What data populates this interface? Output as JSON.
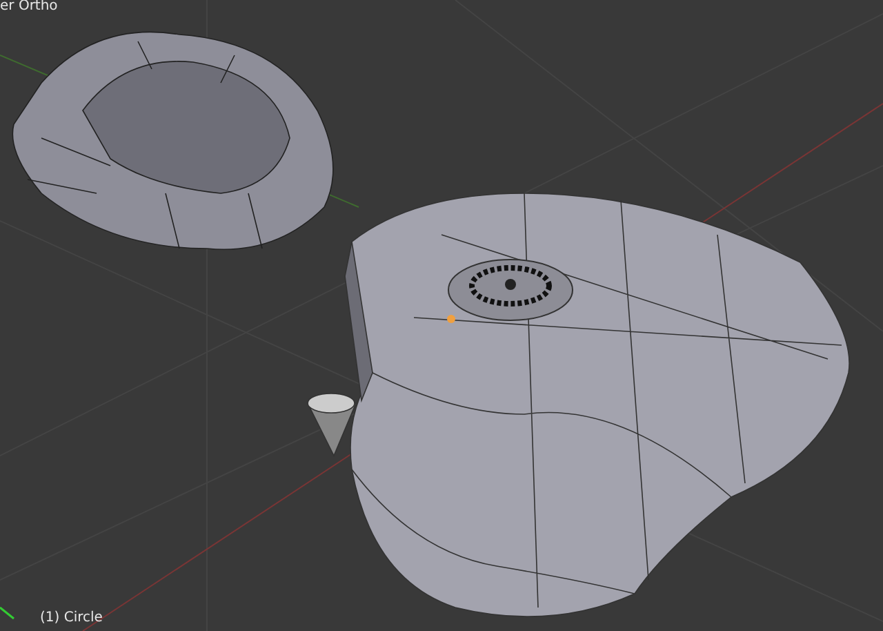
{
  "viewport": {
    "view_label": "er Ortho",
    "object_label": "(1) Circle"
  }
}
